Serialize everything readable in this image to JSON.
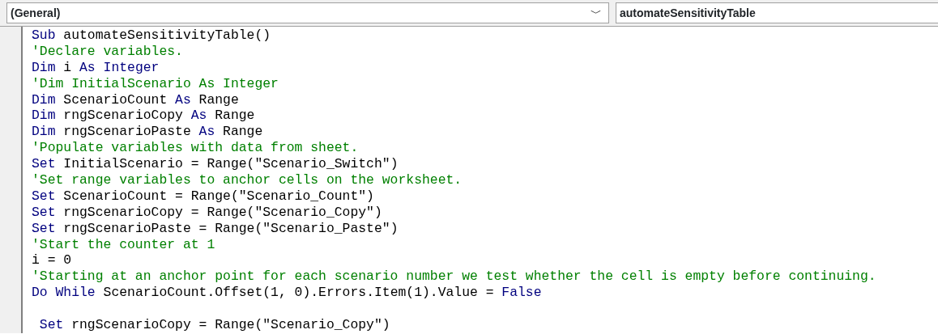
{
  "object_combo": {
    "value": "(General)",
    "caret": "﹀"
  },
  "procedure_combo": {
    "value": "automateSensitivityTable"
  },
  "code_lines": [
    {
      "kind": "code",
      "tokens": [
        {
          "kind": "keyword",
          "text": "Sub"
        },
        {
          "kind": "plain",
          "text": " automateSensitivityTable()"
        }
      ]
    },
    {
      "kind": "code",
      "tokens": [
        {
          "kind": "comment",
          "text": "'Declare variables."
        }
      ]
    },
    {
      "kind": "code",
      "tokens": [
        {
          "kind": "keyword",
          "text": "Dim"
        },
        {
          "kind": "plain",
          "text": " i "
        },
        {
          "kind": "keyword",
          "text": "As Integer"
        }
      ]
    },
    {
      "kind": "code",
      "tokens": [
        {
          "kind": "comment",
          "text": "'Dim InitialScenario As Integer"
        }
      ]
    },
    {
      "kind": "code",
      "tokens": [
        {
          "kind": "keyword",
          "text": "Dim"
        },
        {
          "kind": "plain",
          "text": " ScenarioCount "
        },
        {
          "kind": "keyword",
          "text": "As"
        },
        {
          "kind": "plain",
          "text": " Range"
        }
      ]
    },
    {
      "kind": "code",
      "tokens": [
        {
          "kind": "keyword",
          "text": "Dim"
        },
        {
          "kind": "plain",
          "text": " rngScenarioCopy "
        },
        {
          "kind": "keyword",
          "text": "As"
        },
        {
          "kind": "plain",
          "text": " Range"
        }
      ]
    },
    {
      "kind": "code",
      "tokens": [
        {
          "kind": "keyword",
          "text": "Dim"
        },
        {
          "kind": "plain",
          "text": " rngScenarioPaste "
        },
        {
          "kind": "keyword",
          "text": "As"
        },
        {
          "kind": "plain",
          "text": " Range"
        }
      ]
    },
    {
      "kind": "code",
      "tokens": [
        {
          "kind": "comment",
          "text": "'Populate variables with data from sheet."
        }
      ]
    },
    {
      "kind": "code",
      "tokens": [
        {
          "kind": "keyword",
          "text": "Set"
        },
        {
          "kind": "plain",
          "text": " InitialScenario = Range(\"Scenario_Switch\")"
        }
      ]
    },
    {
      "kind": "code",
      "tokens": [
        {
          "kind": "comment",
          "text": "'Set range variables to anchor cells on the worksheet."
        }
      ]
    },
    {
      "kind": "code",
      "tokens": [
        {
          "kind": "keyword",
          "text": "Set"
        },
        {
          "kind": "plain",
          "text": " ScenarioCount = Range(\"Scenario_Count\")"
        }
      ]
    },
    {
      "kind": "code",
      "tokens": [
        {
          "kind": "keyword",
          "text": "Set"
        },
        {
          "kind": "plain",
          "text": " rngScenarioCopy = Range(\"Scenario_Copy\")"
        }
      ]
    },
    {
      "kind": "code",
      "tokens": [
        {
          "kind": "keyword",
          "text": "Set"
        },
        {
          "kind": "plain",
          "text": " rngScenarioPaste = Range(\"Scenario_Paste\")"
        }
      ]
    },
    {
      "kind": "code",
      "tokens": [
        {
          "kind": "comment",
          "text": "'Start the counter at 1"
        }
      ]
    },
    {
      "kind": "code",
      "tokens": [
        {
          "kind": "plain",
          "text": "i = 0"
        }
      ]
    },
    {
      "kind": "code",
      "tokens": [
        {
          "kind": "comment",
          "text": "'Starting at an anchor point for each scenario number we test whether the cell is empty before continuing."
        }
      ]
    },
    {
      "kind": "code",
      "tokens": [
        {
          "kind": "keyword",
          "text": "Do While"
        },
        {
          "kind": "plain",
          "text": " ScenarioCount.Offset(1, 0).Errors.Item(1).Value = "
        },
        {
          "kind": "keyword",
          "text": "False"
        }
      ]
    },
    {
      "kind": "blank"
    },
    {
      "kind": "code",
      "indented": true,
      "tokens": [
        {
          "kind": "keyword",
          "text": "Set"
        },
        {
          "kind": "plain",
          "text": " rngScenarioCopy = Range(\"Scenario_Copy\")"
        }
      ]
    }
  ]
}
